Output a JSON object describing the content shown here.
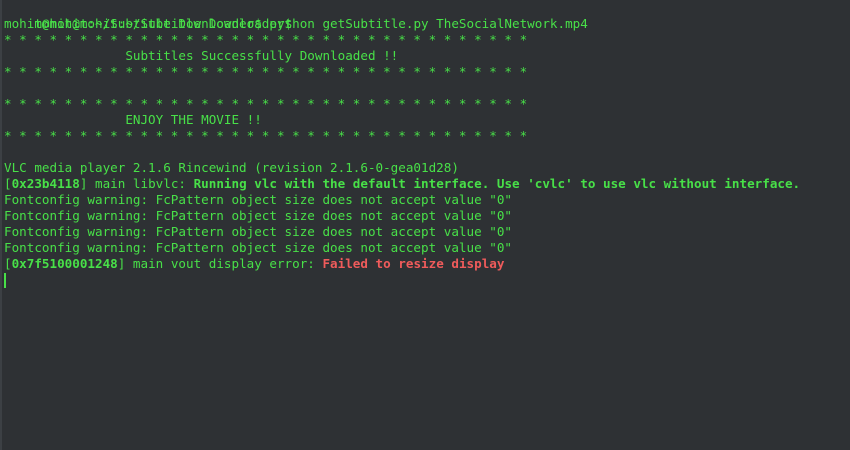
{
  "window": {
    "type": "terminal",
    "colors": {
      "background": "#2e3134",
      "text": "#48e048",
      "error": "#ef5b5b"
    }
  },
  "output": {
    "prompt1": "mohit@mohit:~/Subtitle Downloader$",
    "prompt2": "mohit@mohit:~/Subtitle Downloader$",
    "command": " python getSubtitle.py TheSocialNetwork.mp4",
    "stars": "* * * * * * * * * * * * * * * * * * * * * * * * * * * * * * * * * * *",
    "msg_downloaded": "                Subtitles Successfully Downloaded !!",
    "msg_enjoy": "                ENJOY THE MOVIE !!",
    "vlc_version": "VLC media player 2.1.6 Rincewind (revision 2.1.6-0-gea01d28)",
    "libvlc": {
      "open_bracket": "[",
      "address": "0x23b4118",
      "close_bracket": "] main libvlc: ",
      "message": "Running vlc with the default interface. Use 'cvlc' to use vlc without interface."
    },
    "fontconfig_warnings": [
      "Fontconfig warning: FcPattern object size does not accept value \"0\"",
      "Fontconfig warning: FcPattern object size does not accept value \"0\"",
      "Fontconfig warning: FcPattern object size does not accept value \"0\"",
      "Fontconfig warning: FcPattern object size does not accept value \"0\""
    ],
    "vout_error": {
      "open_bracket": "[",
      "address": "0x7f5100001248",
      "close_bracket": "] main vout display error: ",
      "message": "Failed to resize display"
    }
  }
}
